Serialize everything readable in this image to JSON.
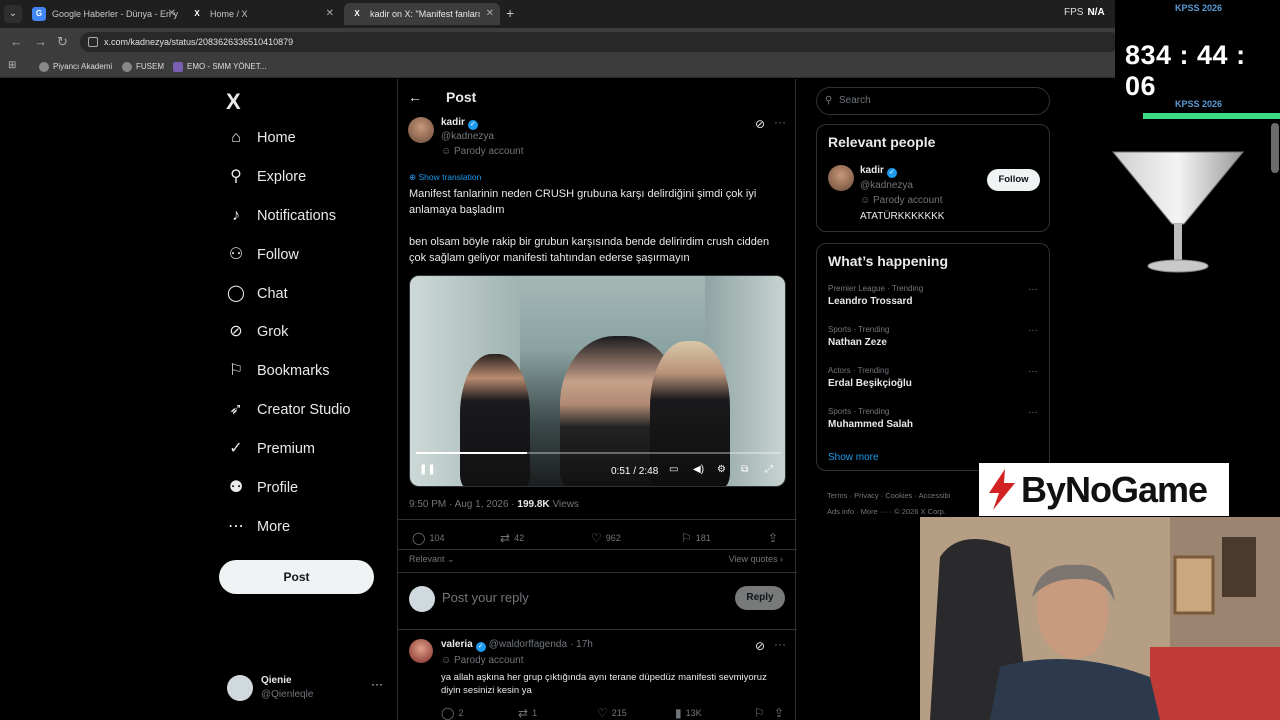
{
  "browser": {
    "tabs": [
      {
        "favicon": "G",
        "title": "Google Haberler - Dünya - En y"
      },
      {
        "favicon": "X",
        "title": "Home / X"
      },
      {
        "favicon": "X",
        "title": "kadir on X: \"Manifest fanları"
      }
    ],
    "fps_label": "FPS",
    "fps_value": "N/A",
    "url": "x.com/kadnezya/status/2083626336510410879",
    "bookmarks": [
      "Piyancı Akademi",
      "FUSEM",
      "EMO - SMM YÖNET..."
    ]
  },
  "sidebar": {
    "logo": "X",
    "items": [
      {
        "label": "Home",
        "icon": "home-icon",
        "glyph": "⌂"
      },
      {
        "label": "Explore",
        "icon": "search-icon",
        "glyph": "⚲"
      },
      {
        "label": "Notifications",
        "icon": "bell-icon",
        "glyph": "♪"
      },
      {
        "label": "Follow",
        "icon": "add-person-icon",
        "glyph": "⚇"
      },
      {
        "label": "Chat",
        "icon": "chat-icon",
        "glyph": "◯"
      },
      {
        "label": "Grok",
        "icon": "grok-icon",
        "glyph": "⊘"
      },
      {
        "label": "Bookmarks",
        "icon": "bookmark-icon",
        "glyph": "⚐"
      },
      {
        "label": "Creator Studio",
        "icon": "rocket-icon",
        "glyph": "➶"
      },
      {
        "label": "Premium",
        "icon": "verified-icon",
        "glyph": "✓"
      },
      {
        "label": "Profile",
        "icon": "person-icon",
        "glyph": "⚉"
      },
      {
        "label": "More",
        "icon": "more-circle-icon",
        "glyph": "⋯"
      }
    ],
    "post_button": "Post",
    "account": {
      "name": "Qienie",
      "handle": "@Qienleqle",
      "more": "···"
    }
  },
  "post": {
    "header_title": "Post",
    "author_name": "kadir",
    "author_handle": "@kadnezya",
    "parody_label": "Parody account",
    "show_translation": "Show translation",
    "text_1": "Manifest fanlarinin neden CRUSH grubuna karşı delirdiğini şimdi çok iyi anlamaya başladım",
    "text_2": "ben olsam böyle rakip bir grubun karşısında bende delirirdim crush cidden çok sağlam geliyor manifesti tahtından ederse şaşırmayın",
    "video": {
      "time": "0:51 / 2:48",
      "progress": 0.304
    },
    "timestamp": "9:50 PM · Aug 1, 2026 · ",
    "views_count": "199.8K",
    "views_label": "Views",
    "stats": {
      "replies": "104",
      "reposts": "42",
      "likes": "962",
      "bookmarks": "181"
    },
    "relevant": "Relevant",
    "view_quotes": "View quotes",
    "reply_placeholder": "Post your reply",
    "reply_button": "Reply"
  },
  "comment": {
    "name": "valeria",
    "handle": "@waldorffagenda",
    "time": "· 17h",
    "parody_label": "Parody account",
    "text": "ya allah aşkına her grup çıktığında aynı terane düpedüz manifesti sevmiyoruz diyin sesinizi kesin ya",
    "stats": {
      "replies": "2",
      "reposts": "1",
      "likes": "215",
      "views": "13K"
    }
  },
  "right": {
    "search_placeholder": "Search",
    "relevant_title": "Relevant people",
    "person": {
      "name": "kadir",
      "handle": "@kadnezya",
      "parody": "Parody account",
      "bio": "ATATÜRKKKKKKK",
      "follow": "Follow"
    },
    "happening_title": "What’s happening",
    "trends": [
      {
        "context": "Premier League · Trending",
        "name": "Leandro Trossard"
      },
      {
        "context": "Sports · Trending",
        "name": "Nathan Zeze"
      },
      {
        "context": "Actors · Trending",
        "name": "Erdal Beşikçioğlu"
      },
      {
        "context": "Sports · Trending",
        "name": "Muhammed Salah"
      }
    ],
    "show_more": "Show more",
    "footer_1": "Terms  ·  Privacy  ·  Cookies  ·  Accessibi",
    "footer_2": "Ads info  ·  More ···  ·  © 2026 X Corp."
  },
  "overlay": {
    "timer_label_top": "KPSS 2026",
    "timer": "834 : 44 : 06",
    "timer_label_bottom": "KPSS 2026",
    "logo": "ByNoGame"
  },
  "colors": {
    "accent": "#1d9bf0",
    "background": "#000000",
    "timer_bar": "#3ddc84"
  }
}
